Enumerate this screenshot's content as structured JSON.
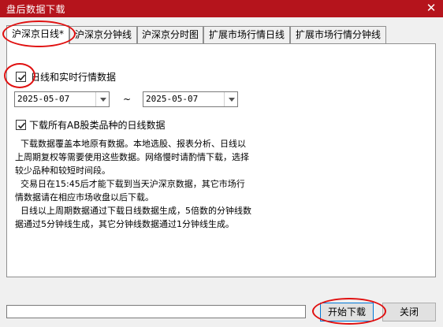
{
  "window": {
    "title": "盘后数据下载",
    "close_glyph": "✕"
  },
  "tabs": [
    {
      "label": "沪深京日线*",
      "active": true
    },
    {
      "label": "沪深京分钟线",
      "active": false
    },
    {
      "label": "沪深京分时图",
      "active": false
    },
    {
      "label": "扩展市场行情日线",
      "active": false
    },
    {
      "label": "扩展市场行情分钟线",
      "active": false
    }
  ],
  "daily": {
    "realtime_checkbox": {
      "label": "日线和实时行情数据",
      "checked": true
    },
    "start_date": "2025-05-07",
    "range_separator": "~",
    "end_date": "2025-05-07",
    "ab_checkbox": {
      "label": "下载所有AB股类品种的日线数据",
      "checked": true
    },
    "description": [
      "  下载数据覆盖本地原有数据。本地选股、报表分析、日线以上周期复权等需要使用这些数据。网络慢时请酌情下载，选择较少品种和较短时间段。",
      "  交易日在15:45后才能下载到当天沪深京数据，其它市场行情数据请在相应市场收盘以后下载。",
      "  日线以上周期数据通过下载日线数据生成，5倍数的分钟线数据通过5分钟线生成，其它分钟线数据通过1分钟线生成。"
    ]
  },
  "footer": {
    "start_label": "开始下载",
    "close_label": "关闭"
  },
  "colors": {
    "titlebar": "#b5141c",
    "highlight_ring": "#e01010"
  }
}
